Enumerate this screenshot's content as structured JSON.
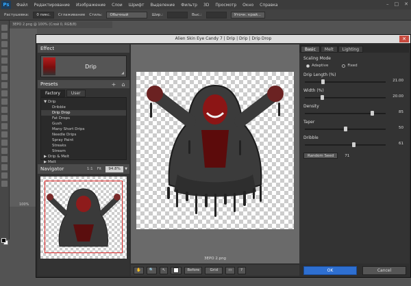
{
  "ps": {
    "logo": "Ps",
    "menu": [
      "Файл",
      "Редактирование",
      "Изображение",
      "Слои",
      "Шрифт",
      "Выделение",
      "Фильтр",
      "3D",
      "Просмотр",
      "Окно",
      "Справка"
    ],
    "options": {
      "rasterize_label": "Растушевка:",
      "rasterize_value": "0 пикс.",
      "smoothing_label": "Сглаживание",
      "style_label": "Стиль:",
      "style_value": "Обычный",
      "width_label": "Шир.:",
      "height_label": "Выс.:",
      "refine_button": "Уточн. край..."
    },
    "doc_tab": "ЗЕРО 2.png @ 100% (Слой 0, RGB/8)",
    "zoom": "100%"
  },
  "dialog": {
    "title": "Alien Skin Eye Candy 7 | Drip | Drip | Drip Drop",
    "effect": {
      "header": "Effect",
      "name": "Drip"
    },
    "presets": {
      "header": "Presets",
      "tabs": [
        "Factory",
        "User"
      ],
      "tree": [
        {
          "label": "▼ Drip",
          "indent": false,
          "selected": false
        },
        {
          "label": "Dribble",
          "indent": true,
          "selected": false
        },
        {
          "label": "Drip Drop",
          "indent": true,
          "selected": true
        },
        {
          "label": "Fat Drops",
          "indent": true,
          "selected": false
        },
        {
          "label": "Gush",
          "indent": true,
          "selected": false
        },
        {
          "label": "Many Short Drips",
          "indent": true,
          "selected": false
        },
        {
          "label": "Needle Drips",
          "indent": true,
          "selected": false
        },
        {
          "label": "Spray Paint",
          "indent": true,
          "selected": false
        },
        {
          "label": "Streaks",
          "indent": true,
          "selected": false
        },
        {
          "label": "Stream",
          "indent": true,
          "selected": false
        },
        {
          "label": "▶ Drip & Melt",
          "indent": false,
          "selected": false
        },
        {
          "label": "▶ Melt",
          "indent": false,
          "selected": false
        }
      ]
    },
    "navigator": {
      "header": "Navigator",
      "one_to_one": "1:1",
      "fit": "Fit",
      "zoom": "94.8%"
    },
    "file_label": "ЗЕРО 2.png",
    "bottom": {
      "before": "Before",
      "grid": "Grid"
    },
    "right": {
      "tabs": [
        "Basic",
        "Melt",
        "Lighting"
      ],
      "scaling_mode": "Scaling Mode",
      "adaptive": "Adaptive",
      "fixed": "Fixed",
      "sliders": [
        {
          "label": "Drip Length (%)",
          "value": "21.00",
          "pos": 0.21
        },
        {
          "label": "Width (%)",
          "value": "20.00",
          "pos": 0.2
        },
        {
          "label": "Density",
          "value": "85",
          "pos": 0.85
        },
        {
          "label": "Taper",
          "value": "50",
          "pos": 0.5
        },
        {
          "label": "Dribble",
          "value": "61",
          "pos": 0.61
        }
      ],
      "random_seed": "Random Seed",
      "seed_value": "71"
    },
    "ok": "OK",
    "cancel": "Cancel"
  }
}
